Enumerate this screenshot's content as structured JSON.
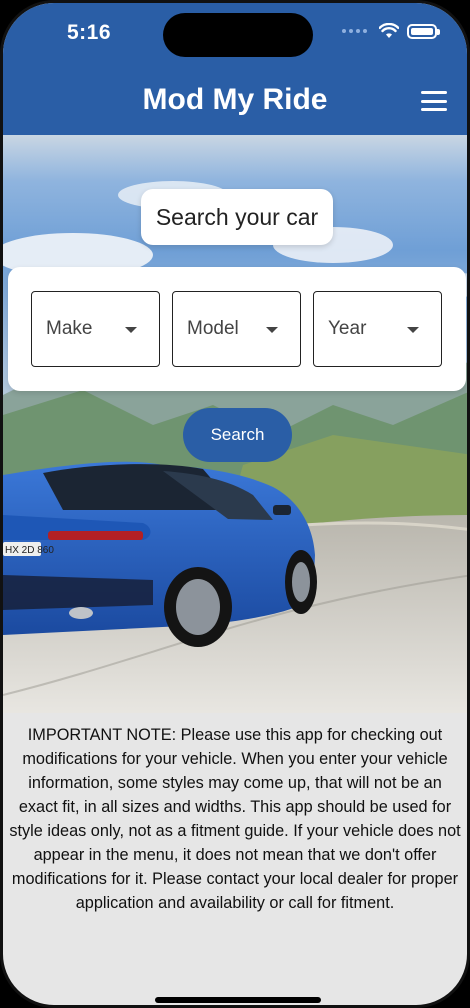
{
  "status": {
    "time": "5:16"
  },
  "app": {
    "title": "Mod My Ride"
  },
  "search": {
    "heading": "Search your car",
    "make_label": "Make",
    "model_label": "Model",
    "year_label": "Year",
    "button_label": "Search"
  },
  "car": {
    "plate_text": "HX 2D 860"
  },
  "note": {
    "text": "IMPORTANT NOTE: Please use this app for checking out modifications for your vehicle. When you enter your vehicle information, some styles may come up, that will not be an exact fit, in all sizes and widths. This app should be used for style ideas only, not as a fitment guide. If your vehicle does not appear in the menu, it does not mean that we don't offer modifications for it. Please contact your local dealer for proper application and availability or call for fitment."
  },
  "colors": {
    "brand": "#2a5ea6",
    "car": "#2a63c7"
  },
  "icons": [
    "wifi-icon",
    "battery-icon",
    "menu-icon",
    "chevron-down-icon"
  ]
}
